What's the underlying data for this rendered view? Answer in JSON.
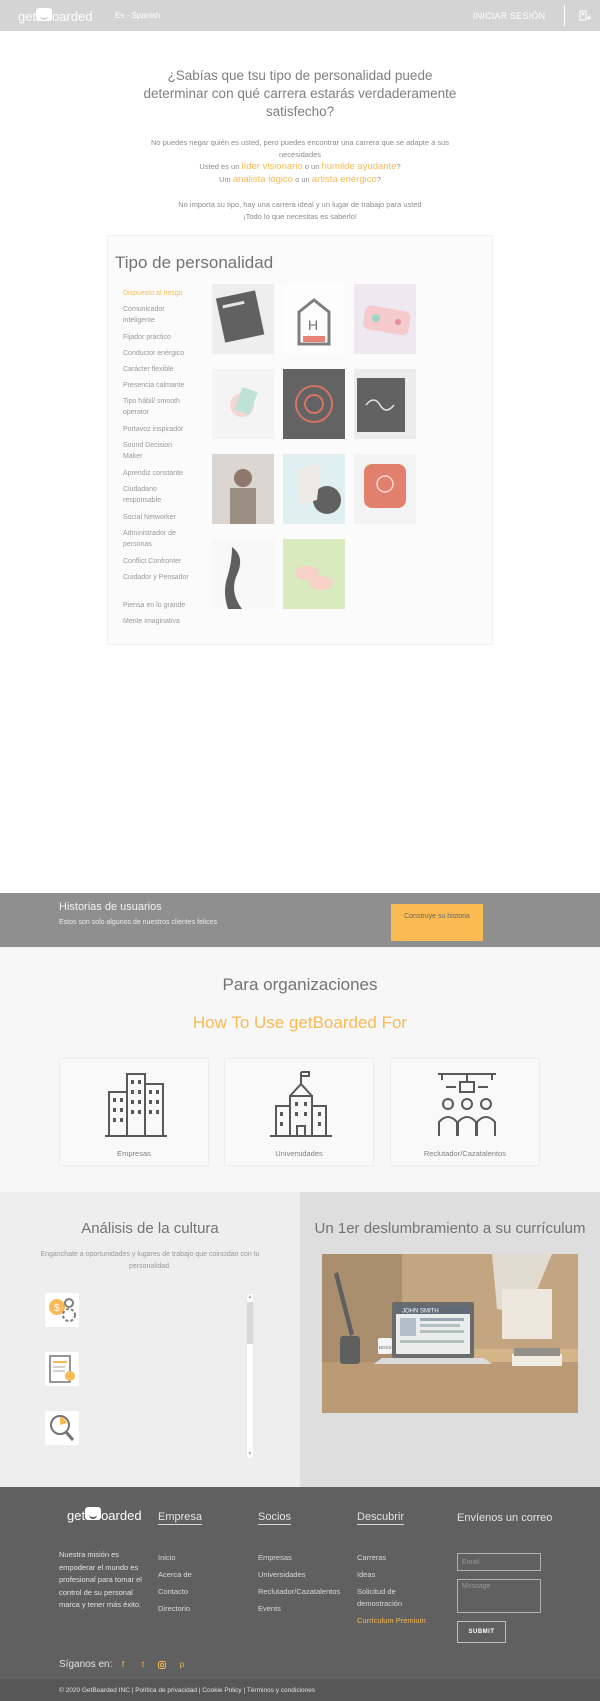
{
  "header": {
    "logo": "get oarded",
    "language": "Es - Spanish",
    "login": "INICIAR SESIÓN",
    "user_icon": "user-add-icon"
  },
  "intro": {
    "question": "¿Sabías que tsu tipo de personalidad puede determinar con qué carrera estarás verdaderamente satisfecho?",
    "line1": "No puedes negar quién es usted, pero puedes encontrar una carrera que se adapte a sus necesidades",
    "l2_pre": "Usted es un ",
    "l2_a": "líder visionario",
    "l2_mid": " o un ",
    "l2_b": "humilde ayudante",
    "l2_end": "?",
    "l3_pre": "Um ",
    "l3_a": "analista lógico",
    "l3_mid": " o un ",
    "l3_b": "artista enérgico",
    "l3_end": "?",
    "line4": "No importa su tipo, hay una carrera ideal y un lugar de trabajo para usted",
    "line5": "¡Todo lo que necesitas es saberlo!"
  },
  "personality": {
    "title": "Tipo de personalidad",
    "items": [
      {
        "label": "Dispuesto al riesgo",
        "active": true
      },
      {
        "label": "Comunicador inteligente"
      },
      {
        "label": "Fijador práctico"
      },
      {
        "label": "Conductor enérgico"
      },
      {
        "label": "Carácter flexible"
      },
      {
        "label": "Presencia calmante"
      },
      {
        "label": "Tipo hábil/ smooth operator"
      },
      {
        "label": "Portavoz inspirador"
      },
      {
        "label": "Sound Decision Maker"
      },
      {
        "label": "Aprendiz constante"
      },
      {
        "label": "Ciudadano responsable"
      },
      {
        "label": "Social Networker"
      },
      {
        "label": "Administrador de personas"
      },
      {
        "label": "Conflict Confronter"
      },
      {
        "label": "Cuidador y Pensador"
      },
      {
        "label": "Piensa en lo grande"
      },
      {
        "label": "Mente imaginativa"
      }
    ]
  },
  "stories": {
    "title": "Historias de usuarios",
    "subtitle": "Estos son solo algunos de nuestros clientes felices",
    "button": "Construye su historia"
  },
  "orgs": {
    "title": "Para organizaciones",
    "subtitle": "How To Use getBoarded For",
    "cards": [
      {
        "label": "Empresas",
        "icon": "office-buildings-icon"
      },
      {
        "label": "Universidades",
        "icon": "university-icon"
      },
      {
        "label": "Reclutador/Cazatalentos",
        "icon": "recruiter-network-icon"
      }
    ]
  },
  "culture": {
    "title": "Análisis de la cultura",
    "subtitle": "Enganchate a oportunidades y lugares de trabajo que coincidan con tu personalidad.",
    "icons": [
      "money-gears-icon",
      "certificate-document-icon",
      "magnifier-chart-icon"
    ]
  },
  "cv": {
    "title": "Un 1er deslumbramiento a su currículum",
    "screen_name": "JOHN SMITH",
    "mug": "BOSS"
  },
  "footer": {
    "logo": "get oarded",
    "mission": "Nuestra misión es empoderar el mundo es profesional para tomar el control de su personal marca y tener más éxito.",
    "col1": {
      "title": "Empresa",
      "links": [
        "Inicio",
        "Acerca de",
        "Contacto",
        "Directorio"
      ]
    },
    "col2": {
      "title": "Socios",
      "links": [
        "Empresas",
        "Universidades",
        "Reclutador/Cazatalentos",
        "Events"
      ]
    },
    "col3": {
      "title": "Descubrir",
      "links": [
        "Carreras",
        "Ideas",
        "Solicitud de demostración",
        "Currículum Premium"
      ]
    },
    "contact": {
      "title": "Envíenos un correo",
      "email_placeholder": "Email",
      "message_placeholder": "Message",
      "submit": "SUBMIT"
    },
    "follow": "Síganos en:",
    "social": [
      "facebook-icon",
      "twitter-icon",
      "instagram-icon",
      "pinterest-icon"
    ],
    "copyright": "© 2020 GetBoarded INC | Política de privacidad | Cookie Policy | Términos y condiciones"
  },
  "colors": {
    "accent": "#f4a31c",
    "header": "#c6c6c6",
    "footer": "#2b2b2b"
  }
}
